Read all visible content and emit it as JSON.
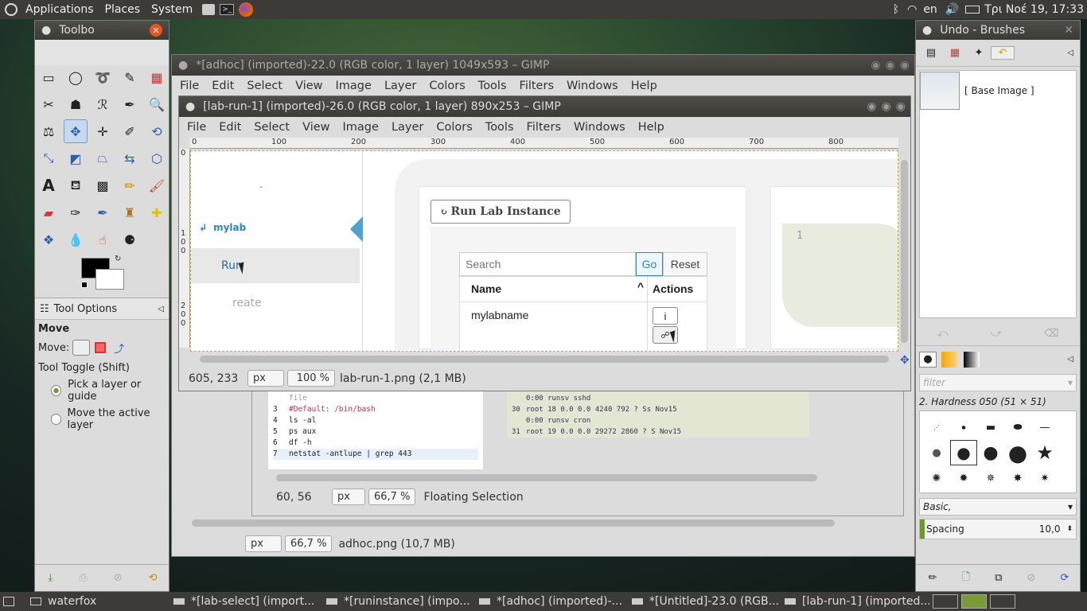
{
  "topbar": {
    "apps": "Applications",
    "places": "Places",
    "system": "System",
    "lang": "en",
    "clock": "Τρι Νοέ 19, 17:33"
  },
  "toolbox": {
    "title": "Toolbo",
    "tool_options": "Tool Options",
    "move_title": "Move",
    "move_label": "Move:",
    "tool_toggle": "Tool Toggle  (Shift)",
    "opt1": "Pick a layer or guide",
    "opt2": "Move the active layer"
  },
  "adhoc": {
    "title": "*[adhoc] (imported)-22.0 (RGB color, 1 layer) 1049x593 – GIMP",
    "coords": "",
    "unit": "px",
    "zoom": "66,7 %",
    "file": "adhoc.png (10,7 MB)"
  },
  "labrun": {
    "title": "[lab-run-1] (imported)-26.0 (RGB color, 1 layer) 890x253 – GIMP",
    "coords": "605, 233",
    "unit": "px",
    "zoom": "100 %",
    "file": "lab-run-1.png (2,1 MB)"
  },
  "menus": [
    "File",
    "Edit",
    "Select",
    "View",
    "Image",
    "Layer",
    "Colors",
    "Tools",
    "Filters",
    "Windows",
    "Help"
  ],
  "ruler_h": [
    "0",
    "100",
    "200",
    "300",
    "400",
    "500",
    "600",
    "700",
    "800"
  ],
  "ruler_v": [
    "0",
    "1",
    "0",
    "0",
    "2",
    "0",
    "0"
  ],
  "canvas": {
    "sidebar_top": "-",
    "mylab": "mylab",
    "run": "Run",
    "create": "reate",
    "btn_run_lab": "Run Lab Instance",
    "search_placeholder": "Search",
    "go": "Go",
    "reset": "Reset",
    "col_name": "Name",
    "col_actions": "Actions",
    "row_name": "mylabname",
    "info": "i",
    "line_num": "1"
  },
  "inner": {
    "coords": "60, 56",
    "unit": "px",
    "zoom": "66,7 %",
    "status": "Floating Selection",
    "code": [
      {
        "n": "",
        "t": "file",
        "c": "#999"
      },
      {
        "n": "3",
        "t": "#Default: /bin/bash",
        "c": "#b35"
      },
      {
        "n": "4",
        "t": "ls -al",
        "c": "#222"
      },
      {
        "n": "5",
        "t": "ps aux",
        "c": "#222"
      },
      {
        "n": "6",
        "t": "df -h",
        "c": "#222"
      },
      {
        "n": "7",
        "t": "netstat -antlupe | grep 443",
        "c": "#222"
      }
    ],
    "proc": [
      {
        "n": "",
        "t": "0:00 runsv sshd"
      },
      {
        "n": "30",
        "t": "root        18  0.0  0.0   4240   792 ?      Ss   Nov15"
      },
      {
        "n": "",
        "t": "0:00 runsv cron"
      },
      {
        "n": "31",
        "t": "root        19  0.0  0.0  29272  2860 ?      S    Nov15"
      }
    ]
  },
  "undo": {
    "title": "Undo - Brushes",
    "base": "[ Base Image ]",
    "filter": "filter",
    "brush_name": "2. Hardness 050 (51 × 51)",
    "preset": "Basic,",
    "spacing_label": "Spacing",
    "spacing_val": "10,0"
  },
  "taskbar": [
    "waterfox",
    "*[lab-select] (import...",
    "*[runinstance] (impo...",
    "*[adhoc] (imported)-...",
    "*[Untitled]-23.0 (RGB...",
    "[lab-run-1] (imported..."
  ]
}
